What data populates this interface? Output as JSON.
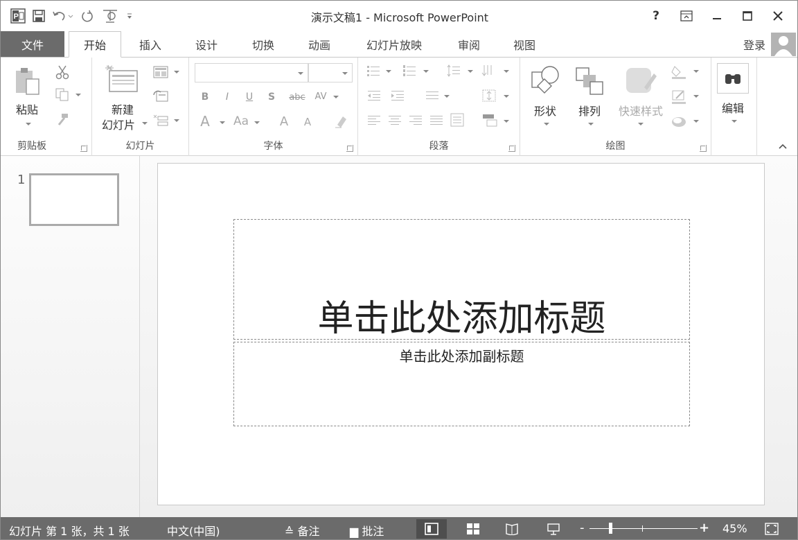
{
  "window": {
    "title": "演示文稿1 - Microsoft PowerPoint",
    "help": "?",
    "controls": [
      "ribbon-display-options",
      "minimize",
      "maximize",
      "close"
    ]
  },
  "quick_access": {
    "app_icon_letter": "P",
    "items": [
      "save-icon",
      "undo-icon",
      "redo-icon",
      "presenter-icon",
      "customize-qat-icon"
    ]
  },
  "tabs": {
    "file": "文件",
    "items": [
      "开始",
      "插入",
      "设计",
      "切换",
      "动画",
      "幻灯片放映",
      "审阅",
      "视图"
    ],
    "active": "开始",
    "signin": "登录"
  },
  "ribbon": {
    "clipboard": {
      "label": "剪贴板",
      "paste": "粘贴"
    },
    "slides": {
      "label": "幻灯片",
      "new_slide_line1": "新建",
      "new_slide_line2": "幻灯片"
    },
    "font": {
      "label": "字体",
      "font_name": "",
      "font_size": "",
      "bold": "B",
      "italic": "I",
      "underline": "U",
      "shadow": "S",
      "strike": "abc",
      "spacing": "AV",
      "font_color": "A",
      "change_case": "Aa",
      "grow": "A",
      "shrink": "A"
    },
    "paragraph": {
      "label": "段落"
    },
    "drawing": {
      "label": "绘图",
      "shapes": "形状",
      "arrange": "排列",
      "quick_styles": "快速样式"
    },
    "editing": {
      "label": "编辑",
      "button": "编辑"
    }
  },
  "thumbnails": [
    {
      "number": "1"
    }
  ],
  "slide": {
    "title_placeholder": "单击此处添加标题",
    "subtitle_placeholder": "单击此处添加副标题"
  },
  "status": {
    "slide_info": "幻灯片 第 1 张，共 1 张",
    "language": "中文(中国)",
    "notes": "备注",
    "comments": "批注",
    "zoom_level": "45%",
    "zoom_fraction": 0.45
  },
  "colors": {
    "file_tab": "#6b6b6b",
    "status_bar": "#6b6b6b"
  }
}
